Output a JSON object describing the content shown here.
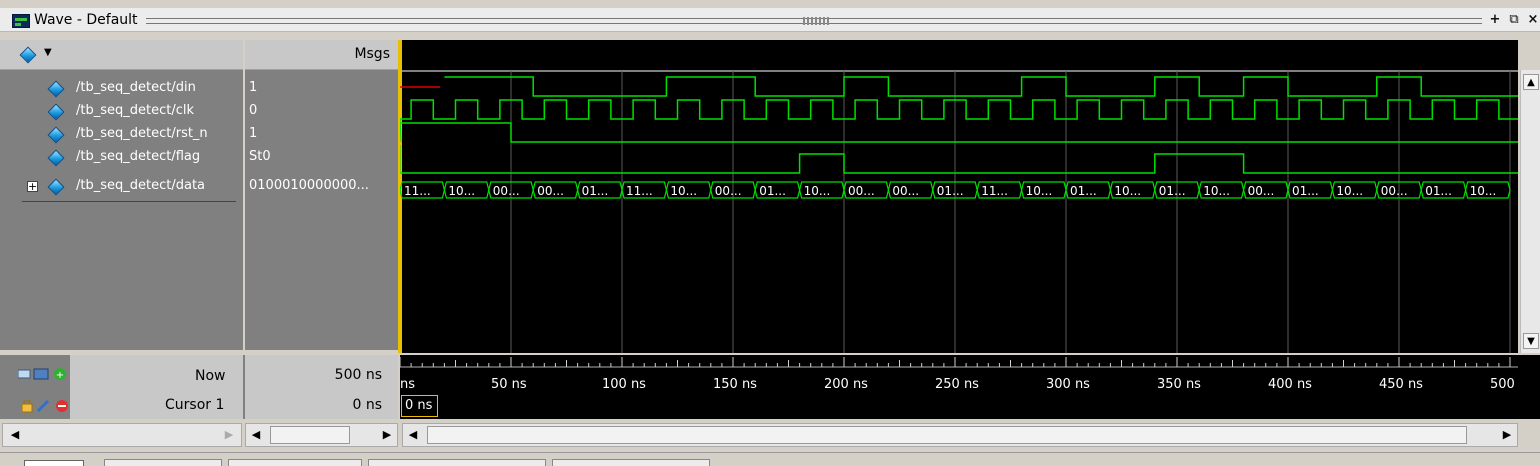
{
  "window": {
    "title": "Wave - Default",
    "buttons": {
      "dock": "+",
      "undock": "⧉",
      "close": "×"
    }
  },
  "header": {
    "msgs_label": "Msgs"
  },
  "signals": [
    {
      "name": "/tb_seq_detect/din",
      "value": "1",
      "icon": "signal-diamond-icon"
    },
    {
      "name": "/tb_seq_detect/clk",
      "value": "0",
      "icon": "signal-diamond-icon"
    },
    {
      "name": "/tb_seq_detect/rst_n",
      "value": "1",
      "icon": "signal-diamond-icon"
    },
    {
      "name": "/tb_seq_detect/flag",
      "value": "St0",
      "icon": "signal-diamond-icon"
    },
    {
      "name": "/tb_seq_detect/data",
      "value": "0100010000000...",
      "icon": "signal-diamond-icon",
      "expandable": true,
      "expander": "+"
    }
  ],
  "data_bus_labels": [
    "11...",
    "10...",
    "00...",
    "00...",
    "01...",
    "11...",
    "10...",
    "00...",
    "01...",
    "10...",
    "00...",
    "00...",
    "01...",
    "11...",
    "10...",
    "01...",
    "10...",
    "01...",
    "10...",
    "00...",
    "01...",
    "10...",
    "00...",
    "01...",
    "10..."
  ],
  "status": {
    "now_label": "Now",
    "now_value": "500 ns",
    "cursor_label": "Cursor 1",
    "cursor_value": "0 ns",
    "cursor_box": "0 ns"
  },
  "timeline": {
    "ticks": [
      "ns",
      "50 ns",
      "100 ns",
      "150 ns",
      "200 ns",
      "250 ns",
      "300 ns",
      "350 ns",
      "400 ns",
      "450 ns",
      "500"
    ]
  },
  "colors": {
    "wave": "#00e000",
    "reset_init": "#e00000",
    "grid": "#5a5a5a",
    "cursor": "#e8c000"
  }
}
